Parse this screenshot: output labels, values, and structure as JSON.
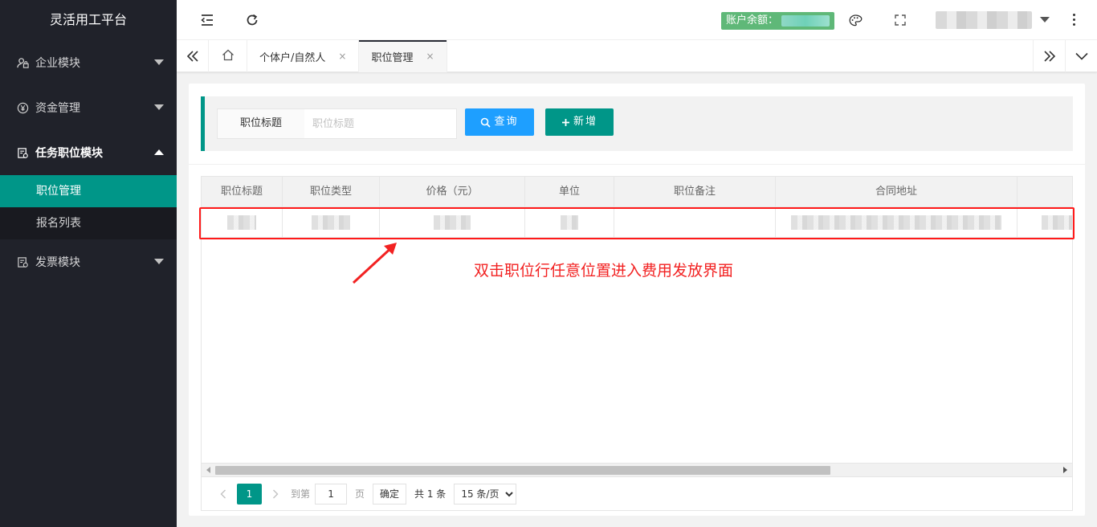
{
  "app": {
    "title": "灵活用工平台"
  },
  "sidebar": {
    "groups": [
      {
        "label": "企业模块",
        "icon": "user-lock-icon",
        "open": false
      },
      {
        "label": "资金管理",
        "icon": "yen-circle-icon",
        "open": false
      },
      {
        "label": "任务职位模块",
        "icon": "task-doc-icon",
        "open": true,
        "items": [
          {
            "label": "职位管理",
            "active": true
          },
          {
            "label": "报名列表",
            "active": false
          }
        ]
      },
      {
        "label": "发票模块",
        "icon": "invoice-icon",
        "open": false
      }
    ]
  },
  "header": {
    "balance_label": "账户余额："
  },
  "tabs": {
    "items": [
      {
        "label": "个体户/自然人",
        "active": false
      },
      {
        "label": "职位管理",
        "active": true
      }
    ],
    "close_glyph": "×"
  },
  "search": {
    "label": "职位标题",
    "placeholder": "职位标题",
    "query_label": "查询",
    "add_label": "新增"
  },
  "table": {
    "columns": [
      "职位标题",
      "职位类型",
      "价格（元）",
      "单位",
      "职位备注",
      "合同地址",
      ""
    ]
  },
  "pagination": {
    "current_page": "1",
    "goto_label": "到第",
    "page_input": "1",
    "page_unit": "页",
    "confirm_label": "确定",
    "total_label": "共 1 条",
    "page_size": "15 条/页"
  },
  "annotation": {
    "text": "双击职位行任意位置进入费用发放界面"
  },
  "colors": {
    "sidebar_bg": "#20222a",
    "accent": "#009688",
    "query_blue": "#1e9fff",
    "balance_green": "#5fb878",
    "highlight_red": "#ff1a1a"
  }
}
